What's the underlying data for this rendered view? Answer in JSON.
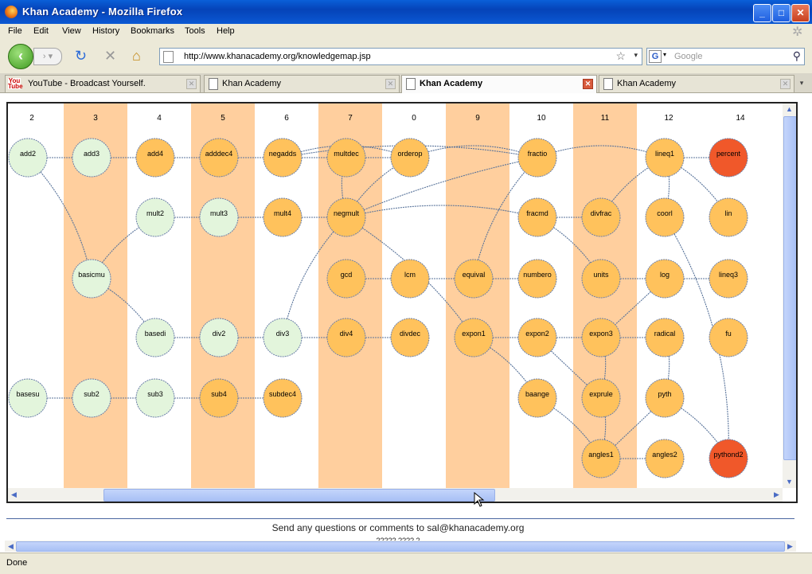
{
  "window": {
    "title": "Khan Academy - Mozilla Firefox"
  },
  "menu": [
    "File",
    "Edit",
    "View",
    "History",
    "Bookmarks",
    "Tools",
    "Help"
  ],
  "nav": {
    "url": "http://www.khanacademy.org/knowledgemap.jsp",
    "search_placeholder": "Google"
  },
  "tabs": [
    {
      "label": "YouTube - Broadcast Yourself.",
      "active": false
    },
    {
      "label": "Khan Academy",
      "active": false
    },
    {
      "label": "Khan Academy",
      "active": true
    },
    {
      "label": "Khan Academy",
      "active": false
    }
  ],
  "map": {
    "columns": [
      "2",
      "3",
      "4",
      "5",
      "6",
      "7",
      "0",
      "9",
      "10",
      "11",
      "12",
      "14"
    ],
    "shaded_columns": [
      "3",
      "5",
      "7",
      "9",
      "11"
    ],
    "colors": {
      "green": "#e3f5dc",
      "orange": "#ffc25c",
      "red": "#f0582a",
      "shade": "#ffcf9e",
      "edge": "#58739a"
    },
    "nodes": [
      {
        "id": "add2",
        "col": 0,
        "row": 0,
        "c": "green"
      },
      {
        "id": "add3",
        "col": 1,
        "row": 0,
        "c": "green"
      },
      {
        "id": "add4",
        "col": 2,
        "row": 0,
        "c": "orange"
      },
      {
        "id": "adddec4",
        "col": 3,
        "row": 0,
        "c": "orange"
      },
      {
        "id": "negadds",
        "col": 4,
        "row": 0,
        "c": "orange"
      },
      {
        "id": "multdec",
        "col": 5,
        "row": 0,
        "c": "orange"
      },
      {
        "id": "orderop",
        "col": 6,
        "row": 0,
        "c": "orange"
      },
      {
        "id": "fractio",
        "col": 8,
        "row": 0,
        "c": "orange"
      },
      {
        "id": "lineq1",
        "col": 10,
        "row": 0,
        "c": "orange"
      },
      {
        "id": "percent",
        "col": 11,
        "row": 0,
        "c": "red"
      },
      {
        "id": "mult2",
        "col": 2,
        "row": 1,
        "c": "green"
      },
      {
        "id": "mult3",
        "col": 3,
        "row": 1,
        "c": "green"
      },
      {
        "id": "mult4",
        "col": 4,
        "row": 1,
        "c": "orange"
      },
      {
        "id": "negmult",
        "col": 5,
        "row": 1,
        "c": "orange"
      },
      {
        "id": "fracmd",
        "col": 8,
        "row": 1,
        "c": "orange"
      },
      {
        "id": "divfrac",
        "col": 9,
        "row": 1,
        "c": "orange"
      },
      {
        "id": "coorl",
        "col": 10,
        "row": 1,
        "c": "orange"
      },
      {
        "id": "lin",
        "col": 11,
        "row": 1,
        "c": "orange"
      },
      {
        "id": "basicmu",
        "col": 1,
        "row": 2,
        "c": "green"
      },
      {
        "id": "gcd",
        "col": 5,
        "row": 2,
        "c": "orange"
      },
      {
        "id": "lcm",
        "col": 6,
        "row": 2,
        "c": "orange"
      },
      {
        "id": "equival",
        "col": 7,
        "row": 2,
        "c": "orange"
      },
      {
        "id": "numbero",
        "col": 8,
        "row": 2,
        "c": "orange"
      },
      {
        "id": "units",
        "col": 9,
        "row": 2,
        "c": "orange"
      },
      {
        "id": "log",
        "col": 10,
        "row": 2,
        "c": "orange"
      },
      {
        "id": "lineq3",
        "col": 11,
        "row": 2,
        "c": "orange"
      },
      {
        "id": "basedi",
        "col": 2,
        "row": 3,
        "c": "green"
      },
      {
        "id": "div2",
        "col": 3,
        "row": 3,
        "c": "green"
      },
      {
        "id": "div3",
        "col": 4,
        "row": 3,
        "c": "green"
      },
      {
        "id": "div4",
        "col": 5,
        "row": 3,
        "c": "orange"
      },
      {
        "id": "divdec",
        "col": 6,
        "row": 3,
        "c": "orange"
      },
      {
        "id": "expon1",
        "col": 7,
        "row": 3,
        "c": "orange"
      },
      {
        "id": "expon2",
        "col": 8,
        "row": 3,
        "c": "orange"
      },
      {
        "id": "expon3",
        "col": 9,
        "row": 3,
        "c": "orange"
      },
      {
        "id": "radical",
        "col": 10,
        "row": 3,
        "c": "orange"
      },
      {
        "id": "fu",
        "col": 11,
        "row": 3,
        "c": "orange"
      },
      {
        "id": "basesu",
        "col": 0,
        "row": 4,
        "c": "green"
      },
      {
        "id": "sub2",
        "col": 1,
        "row": 4,
        "c": "green"
      },
      {
        "id": "sub3",
        "col": 2,
        "row": 4,
        "c": "green"
      },
      {
        "id": "sub4",
        "col": 3,
        "row": 4,
        "c": "orange"
      },
      {
        "id": "subdec4",
        "col": 4,
        "row": 4,
        "c": "orange"
      },
      {
        "id": "baange",
        "col": 8,
        "row": 4,
        "c": "orange"
      },
      {
        "id": "exprule",
        "col": 9,
        "row": 4,
        "c": "orange"
      },
      {
        "id": "pyth",
        "col": 10,
        "row": 4,
        "c": "orange"
      },
      {
        "id": "angles1",
        "col": 9,
        "row": 5,
        "c": "orange"
      },
      {
        "id": "angles2",
        "col": 10,
        "row": 5,
        "c": "orange"
      },
      {
        "id": "pythond2",
        "col": 11,
        "row": 5,
        "c": "red"
      }
    ],
    "edges": [
      [
        "add2",
        "add3"
      ],
      [
        "add3",
        "add4"
      ],
      [
        "add4",
        "adddec4"
      ],
      [
        "adddec4",
        "negadds"
      ],
      [
        "negadds",
        "multdec"
      ],
      [
        "multdec",
        "orderop"
      ],
      [
        "orderop",
        "fractio"
      ],
      [
        "fractio",
        "lineq1"
      ],
      [
        "lineq1",
        "percent"
      ],
      [
        "negadds",
        "fractio"
      ],
      [
        "negadds",
        "orderop"
      ],
      [
        "add2",
        "basicmu"
      ],
      [
        "mult2",
        "mult3"
      ],
      [
        "mult3",
        "mult4"
      ],
      [
        "mult4",
        "negmult"
      ],
      [
        "negmult",
        "multdec"
      ],
      [
        "negmult",
        "orderop"
      ],
      [
        "negmult",
        "fracmd"
      ],
      [
        "negmult",
        "fractio"
      ],
      [
        "fracmd",
        "divfrac"
      ],
      [
        "divfrac",
        "lineq1"
      ],
      [
        "lineq1",
        "coorl"
      ],
      [
        "lineq1",
        "lin"
      ],
      [
        "fracmd",
        "units"
      ],
      [
        "basicmu",
        "mult2"
      ],
      [
        "basicmu",
        "basedi"
      ],
      [
        "gcd",
        "lcm"
      ],
      [
        "lcm",
        "equival"
      ],
      [
        "equival",
        "numbero"
      ],
      [
        "equival",
        "fractio"
      ],
      [
        "units",
        "log"
      ],
      [
        "basedi",
        "div2"
      ],
      [
        "div2",
        "div3"
      ],
      [
        "div3",
        "div4"
      ],
      [
        "div4",
        "divdec"
      ],
      [
        "div3",
        "negmult"
      ],
      [
        "negmult",
        "expon1"
      ],
      [
        "expon1",
        "expon2"
      ],
      [
        "expon2",
        "expon3"
      ],
      [
        "expon3",
        "radical"
      ],
      [
        "expon3",
        "exprule"
      ],
      [
        "radical",
        "pyth"
      ],
      [
        "log",
        "expon3"
      ],
      [
        "expon1",
        "baange"
      ],
      [
        "coorl",
        "pythond2"
      ],
      [
        "lineq3",
        "log"
      ],
      [
        "basesu",
        "sub2"
      ],
      [
        "sub2",
        "sub3"
      ],
      [
        "sub3",
        "sub4"
      ],
      [
        "sub4",
        "subdec4"
      ],
      [
        "baange",
        "angles1"
      ],
      [
        "exprule",
        "angles1"
      ],
      [
        "pyth",
        "angles1"
      ],
      [
        "angles1",
        "angles2"
      ],
      [
        "pyth",
        "pythond2"
      ],
      [
        "exprule",
        "expon2"
      ]
    ]
  },
  "footer": {
    "contact": "Send any questions or comments to sal@khanacademy.org",
    "more": "????? ???? ?"
  },
  "status": "Done"
}
